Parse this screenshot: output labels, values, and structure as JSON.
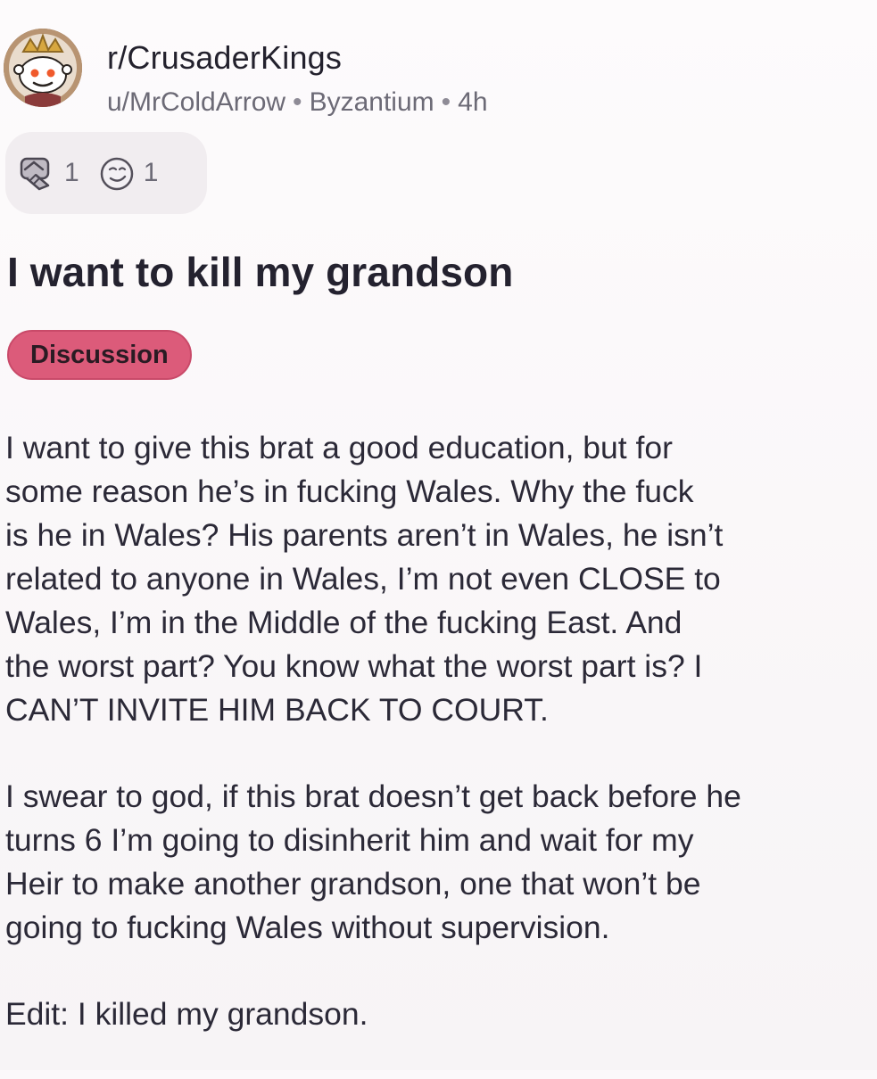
{
  "post": {
    "subreddit": "r/CrusaderKings",
    "author": "u/MrColdArrow",
    "author_flair": "Byzantium",
    "age": "4h",
    "separator": "•",
    "title": "I want to kill my grandson",
    "flair": "Discussion",
    "flair_color": "#dc5b7a",
    "awards": [
      {
        "icon": "handshake-award-icon",
        "count": "1"
      },
      {
        "icon": "smiling-face-award-icon",
        "count": "1"
      }
    ],
    "body_lines_1": "I want to give this brat a good education, but for\nsome reason he’s in fucking Wales. Why the fuck\nis he in Wales? His parents aren’t in Wales, he isn’t\nrelated to anyone in Wales, I’m not even CLOSE to\nWales, I’m in the Middle of the fucking East. And\nthe worst part? You know what the worst part is? I\nCAN’T INVITE HIM BACK TO COURT.",
    "body_lines_2": "I swear to god, if this brat doesn’t get back before he\nturns 6 I’m going to disinherit him and wait for my\nHeir to make another grandson, one that won’t be\ngoing to fucking Wales without supervision.",
    "body_lines_3": "Edit: I killed my grandson."
  }
}
